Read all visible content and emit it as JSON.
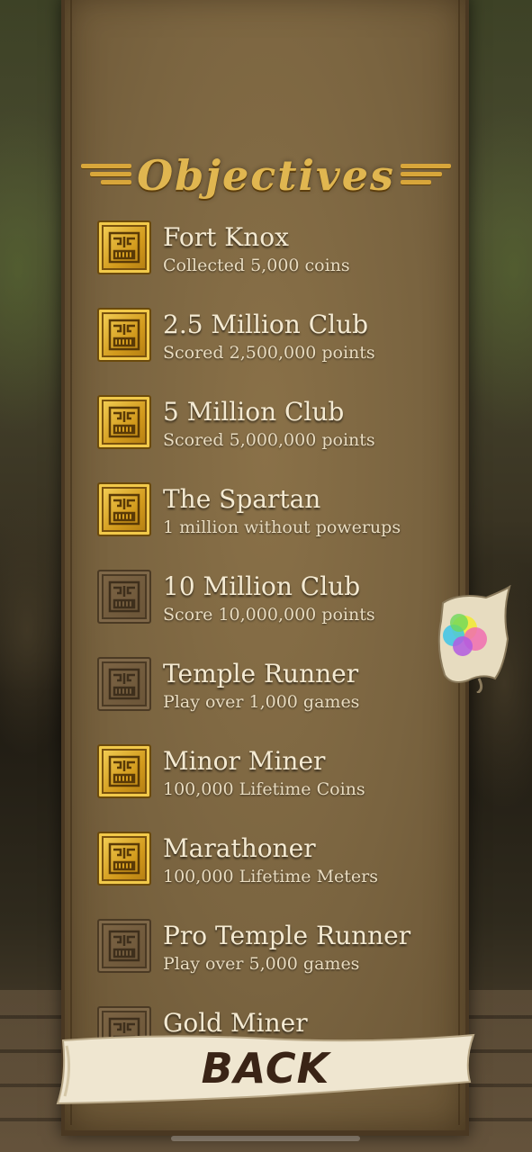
{
  "title": "Objectives",
  "objectives": [
    {
      "title": "Fort Knox",
      "desc": "Collected 5,000 coins",
      "status": "earned"
    },
    {
      "title": "2.5 Million Club",
      "desc": "Scored 2,500,000 points",
      "status": "earned"
    },
    {
      "title": "5 Million Club",
      "desc": "Scored 5,000,000 points",
      "status": "earned"
    },
    {
      "title": "The Spartan",
      "desc": "1 million without powerups",
      "status": "earned"
    },
    {
      "title": "10 Million Club",
      "desc": "Score 10,000,000 points",
      "status": "locked"
    },
    {
      "title": "Temple Runner",
      "desc": "Play over 1,000 games",
      "status": "locked"
    },
    {
      "title": "Minor Miner",
      "desc": "100,000 Lifetime Coins",
      "status": "earned"
    },
    {
      "title": "Marathoner",
      "desc": "100,000 Lifetime Meters",
      "status": "earned"
    },
    {
      "title": "Pro Temple Runner",
      "desc": "Play over 5,000 games",
      "status": "locked"
    },
    {
      "title": "Gold Miner",
      "desc": "",
      "status": "locked"
    }
  ],
  "back_label": "BACK",
  "icons": {
    "badge": "idol-face-icon",
    "game_center": "game-center-icon"
  },
  "colors": {
    "earned_gold": "#e0b650",
    "locked_stone": "#6a5437",
    "parchment": "#7a6440",
    "text": "#f4ead2"
  }
}
